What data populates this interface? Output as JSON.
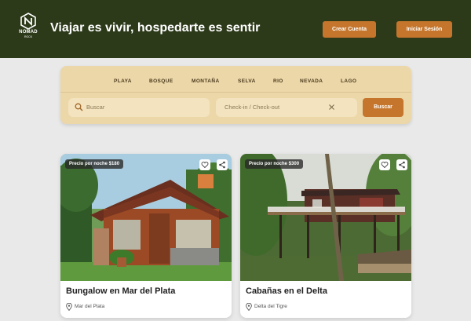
{
  "brand": {
    "name": "NOMAD",
    "sub": "ROCK"
  },
  "header": {
    "tagline": "Viajar es vivir, hospedarte es sentir",
    "create_account": "Crear Cuenta",
    "login": "Iniciar Sesión"
  },
  "categories": [
    "PLAYA",
    "BOSQUE",
    "MONTAÑA",
    "SELVA",
    "RIO",
    "NEVADA",
    "LAGO"
  ],
  "search": {
    "placeholder": "Buscar",
    "dates_placeholder": "Check-in / Check-out",
    "button": "Buscar"
  },
  "listings": [
    {
      "price": "Precio por noche $180",
      "title": "Bungalow en Mar del Plata",
      "location": "Mar del Plata"
    },
    {
      "price": "Precio por noche $300",
      "title": "Cabañas en el Delta",
      "location": "Delta del Tigre"
    }
  ],
  "colors": {
    "header_bg": "#2d3a1a",
    "accent": "#c5762c",
    "panel": "#ecd7a9",
    "field": "#f3e3be"
  },
  "icons": [
    "logo-icon",
    "search-icon",
    "clear-icon",
    "heart-icon",
    "share-icon",
    "location-pin-icon"
  ]
}
